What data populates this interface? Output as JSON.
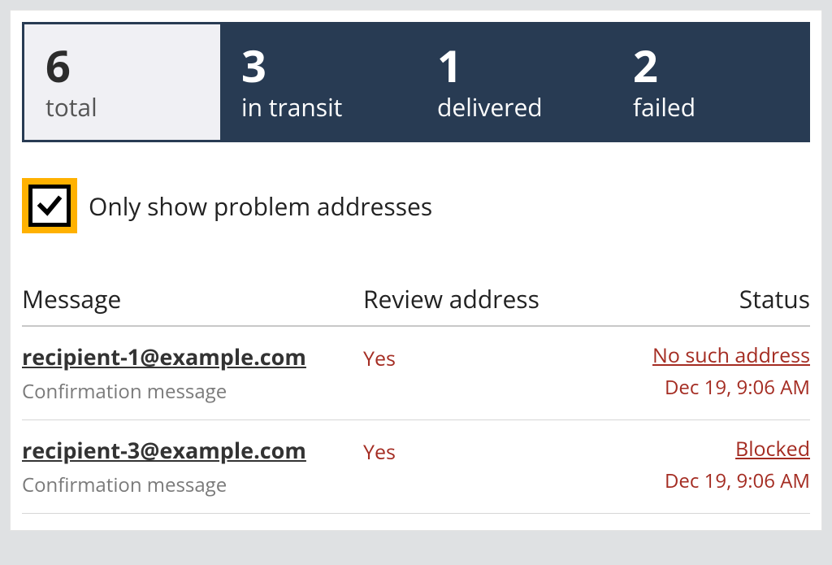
{
  "tabs": [
    {
      "count": "6",
      "label": "total",
      "active": true
    },
    {
      "count": "3",
      "label": "in transit",
      "active": false
    },
    {
      "count": "1",
      "label": "delivered",
      "active": false
    },
    {
      "count": "2",
      "label": "failed",
      "active": false
    }
  ],
  "filter": {
    "checked": true,
    "label": "Only show problem addresses"
  },
  "columns": {
    "message": "Message",
    "review": "Review address",
    "status": "Status"
  },
  "rows": [
    {
      "address": "recipient-1@example.com",
      "subject": "Confirmation message",
      "review": "Yes",
      "status": "No such address",
      "time": "Dec 19, 9:06 AM"
    },
    {
      "address": "recipient-3@example.com",
      "subject": "Confirmation message",
      "review": "Yes",
      "status": "Blocked",
      "time": "Dec 19, 9:06 AM"
    }
  ]
}
